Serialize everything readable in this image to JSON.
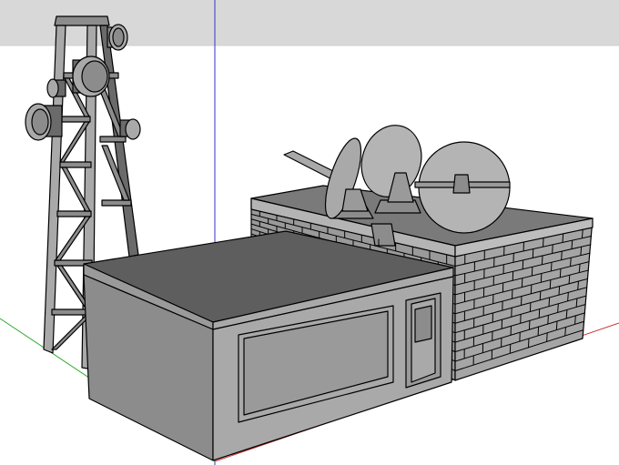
{
  "viewport": {
    "sky_color": "#d8d8d8",
    "ground_color": "#ffffff",
    "line_color": "#000000"
  },
  "axes": {
    "blue_axis_color": "#3333cc",
    "red_axis_color": "#cc3333",
    "green_axis_color": "#33aa33"
  },
  "scene": {
    "objects": [
      "lattice-tower",
      "flat-roof-building",
      "brick-building",
      "satellite-dish-left",
      "satellite-dish-middle",
      "satellite-dish-right"
    ],
    "materials": {
      "light_face": "#a9a9a9",
      "mid_face": "#8c8c8c",
      "dark_face": "#6a6a6a",
      "roof": "#5e5e5e",
      "brick_face": "#9a9a9a"
    }
  }
}
